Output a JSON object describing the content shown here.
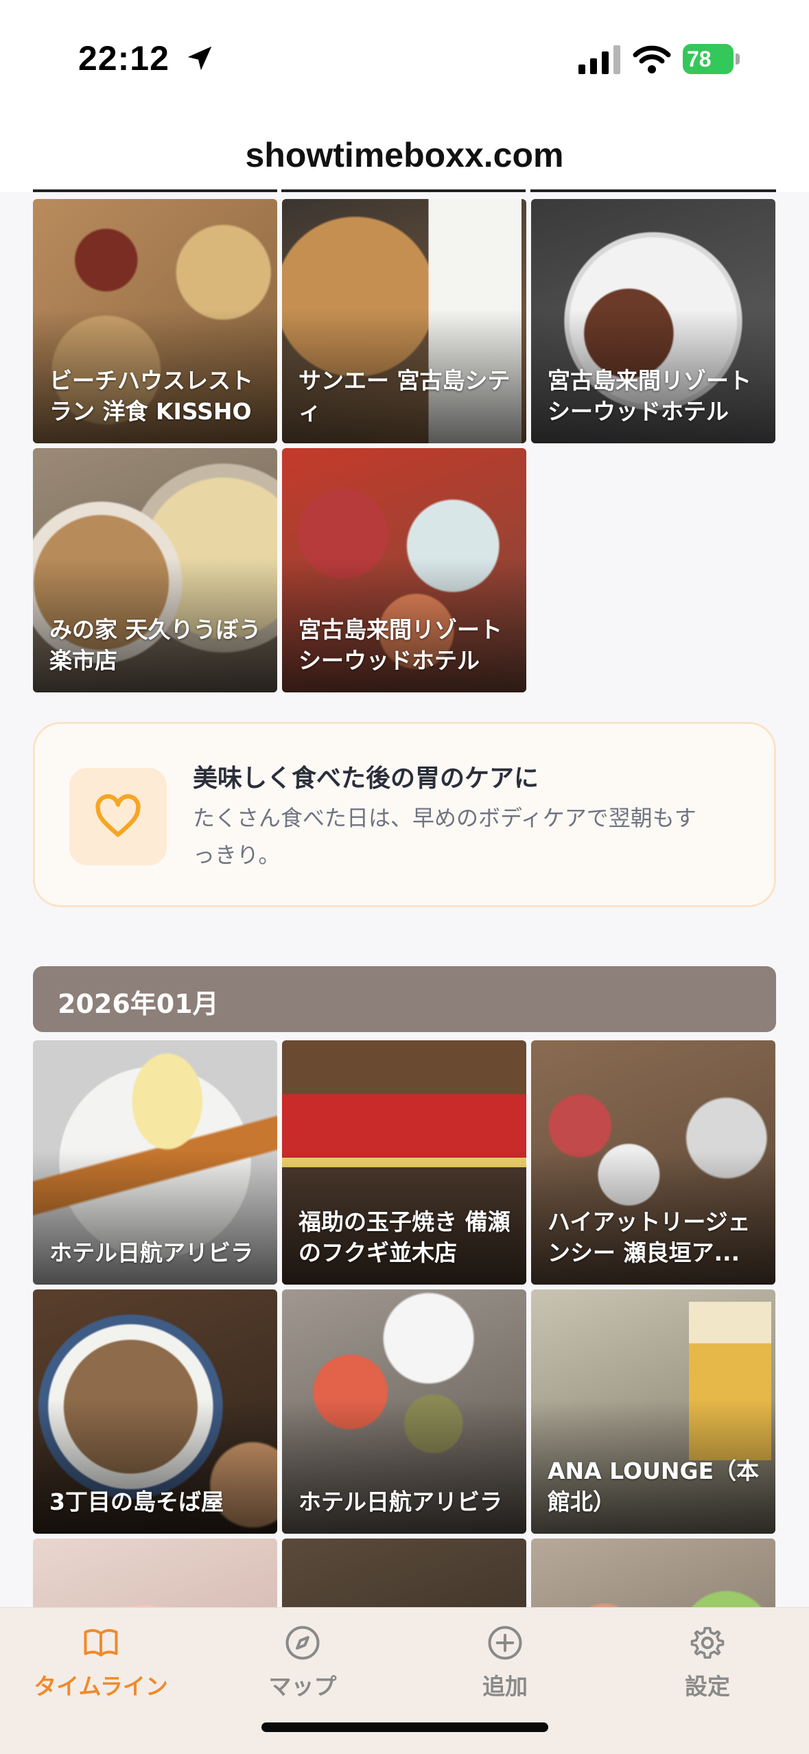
{
  "status_bar": {
    "time": "22:12",
    "battery": "78"
  },
  "url_bar": {
    "domain": "showtimeboxx.com"
  },
  "first_section": {
    "items": [
      {
        "label": "ビーチハウスレストラン 洋食 KISSHO"
      },
      {
        "label": "サンエー 宮古島シティ"
      },
      {
        "label": "宮古島来間リゾート シーウッドホテル"
      },
      {
        "label": "みの家 天久りうぼう楽市店"
      },
      {
        "label": "宮古島来間リゾート シーウッドホテル"
      }
    ]
  },
  "care_card": {
    "title": "美味しく食べた後の胃のケアに",
    "description": "たくさん食べた日は、早めのボディケアで翌朝もすっきり。",
    "icon": "heart-icon",
    "accent_color": "#f5a623"
  },
  "month_section": {
    "header": "2026年01月",
    "items": [
      {
        "label": "ホテル日航アリビラ"
      },
      {
        "label": "福助の玉子焼き 備瀬のフクギ並木店"
      },
      {
        "label": "ハイアットリージェンシー 瀬良垣ア..."
      },
      {
        "label": "3丁目の島そば屋"
      },
      {
        "label": "ホテル日航アリビラ"
      },
      {
        "label": "ANA LOUNGE（本館北）"
      },
      {
        "label": ""
      },
      {
        "label": ""
      },
      {
        "label": ""
      }
    ]
  },
  "tab_bar": {
    "tabs": [
      {
        "label": "タイムライン",
        "icon": "book-icon",
        "active": true
      },
      {
        "label": "マップ",
        "icon": "compass-icon",
        "active": false
      },
      {
        "label": "追加",
        "icon": "plus-circle-icon",
        "active": false
      },
      {
        "label": "設定",
        "icon": "gear-icon",
        "active": false
      }
    ],
    "active_color": "#f08a2c"
  }
}
